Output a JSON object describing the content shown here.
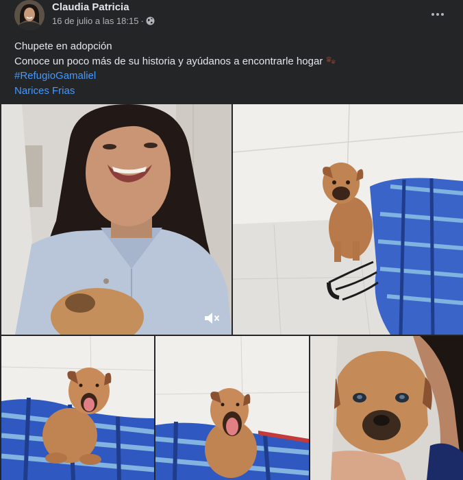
{
  "post": {
    "author": "Claudia Patricia",
    "timestamp": "16 de julio a las 18:15",
    "separator": "·",
    "privacy_icon": "globe-icon",
    "more_icon": "more-options-icon",
    "text_lines": [
      "Chupete en adopción",
      "Conoce un poco más de su historia y ayúdanos a encontrarle hogar"
    ],
    "emoji_icon": "paw-prints-icon",
    "hashtag": "#RefugioGamaliel",
    "page_tag": "Narices Frias",
    "media": [
      {
        "kind": "video",
        "icon": "muted-speaker-icon"
      },
      {
        "kind": "photo"
      },
      {
        "kind": "photo"
      },
      {
        "kind": "photo"
      },
      {
        "kind": "photo"
      }
    ]
  },
  "colors": {
    "background": "#242526",
    "text_primary": "#e4e6eb",
    "text_secondary": "#b0b3b8",
    "link": "#4599ff"
  }
}
